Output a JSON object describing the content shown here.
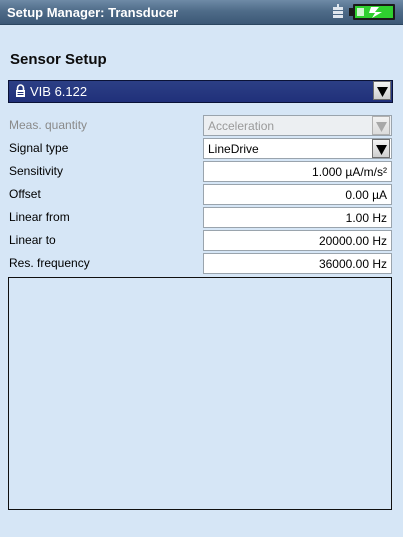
{
  "window": {
    "title": "Setup Manager: Transducer"
  },
  "status_icons": [
    "plug-icon",
    "battery-icon"
  ],
  "section": {
    "title": "Sensor Setup"
  },
  "sensor": {
    "selected": "VIB 6.122",
    "icon": "lock-icon"
  },
  "params": [
    {
      "label": "Meas. quantity",
      "value": "Acceleration",
      "kind": "dropdown",
      "enabled": false
    },
    {
      "label": "Signal type",
      "value": "LineDrive",
      "kind": "dropdown",
      "enabled": true
    },
    {
      "label": "Sensitivity",
      "value": "1.000 µA/m/s²",
      "kind": "number",
      "enabled": true
    },
    {
      "label": "Offset",
      "value": "0.00 µA",
      "kind": "number",
      "enabled": true
    },
    {
      "label": "Linear from",
      "value": "1.00 Hz",
      "kind": "number",
      "enabled": true
    },
    {
      "label": "Linear to",
      "value": "20000.00 Hz",
      "kind": "number",
      "enabled": true
    },
    {
      "label": "Res. frequency",
      "value": "36000.00 Hz",
      "kind": "number",
      "enabled": true
    }
  ],
  "colors": {
    "titlebar": "#4f6c89",
    "background": "#d6e6f6",
    "selection": "#20307a",
    "battery": "#2fd02f"
  }
}
